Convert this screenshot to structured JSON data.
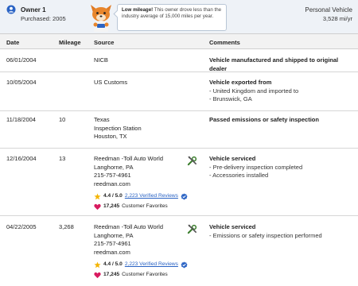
{
  "owner": {
    "title": "Owner 1",
    "purchased": "Purchased: 2005",
    "vehicle_type": "Personal Vehicle",
    "mileage_rate": "3,528 mi/yr"
  },
  "bubble": {
    "headline": "Low mileage!",
    "text": "This owner drove less than the industry average of 15,000 miles per year."
  },
  "columns": {
    "date": "Date",
    "mileage": "Mileage",
    "source": "Source",
    "comments": "Comments"
  },
  "rows": [
    {
      "date": "06/01/2004",
      "mileage": "",
      "source": [
        "NICB"
      ],
      "comment_title": "Vehicle manufactured and shipped to original dealer",
      "comment_items": []
    },
    {
      "date": "10/05/2004",
      "mileage": "",
      "source": [
        "US Customs"
      ],
      "comment_title": "Vehicle exported from",
      "comment_items": [
        "- United Kingdom and imported to",
        "- Brunswick, GA"
      ]
    },
    {
      "date": "11/18/2004",
      "mileage": "10",
      "source": [
        "Texas",
        "Inspection Station",
        "Houston, TX"
      ],
      "comment_title": "Passed emissions or safety inspection",
      "comment_items": []
    },
    {
      "date": "12/16/2004",
      "mileage": "13",
      "source": [
        "Reedman -Toll Auto World",
        "Langhorne, PA",
        "215-757-4961",
        "reedman.com"
      ],
      "rating": "4.4 / 5.0",
      "reviews": "2,223 Verified Reviews",
      "favorites_count": "17,245",
      "favorites_label": "Customer Favorites",
      "comment_title": "Vehicle serviced",
      "comment_items": [
        "- Pre-delivery inspection completed",
        "- Accessories installed"
      ]
    },
    {
      "date": "04/22/2005",
      "mileage": "3,268",
      "source": [
        "Reedman -Toll Auto World",
        "Langhorne, PA",
        "215-757-4961",
        "reedman.com"
      ],
      "rating": "4.4 / 5.0",
      "reviews": "2,223 Verified Reviews",
      "favorites_count": "17,245",
      "favorites_label": "Customer Favorites",
      "comment_title": "Vehicle serviced",
      "comment_items": [
        "- Emissions or safety inspection performed"
      ]
    }
  ],
  "colors": {
    "header_bg": "#eef2f7",
    "link": "#2a63c4",
    "star": "#f4b400",
    "heart": "#d81b60",
    "verified": "#2a63c4"
  }
}
